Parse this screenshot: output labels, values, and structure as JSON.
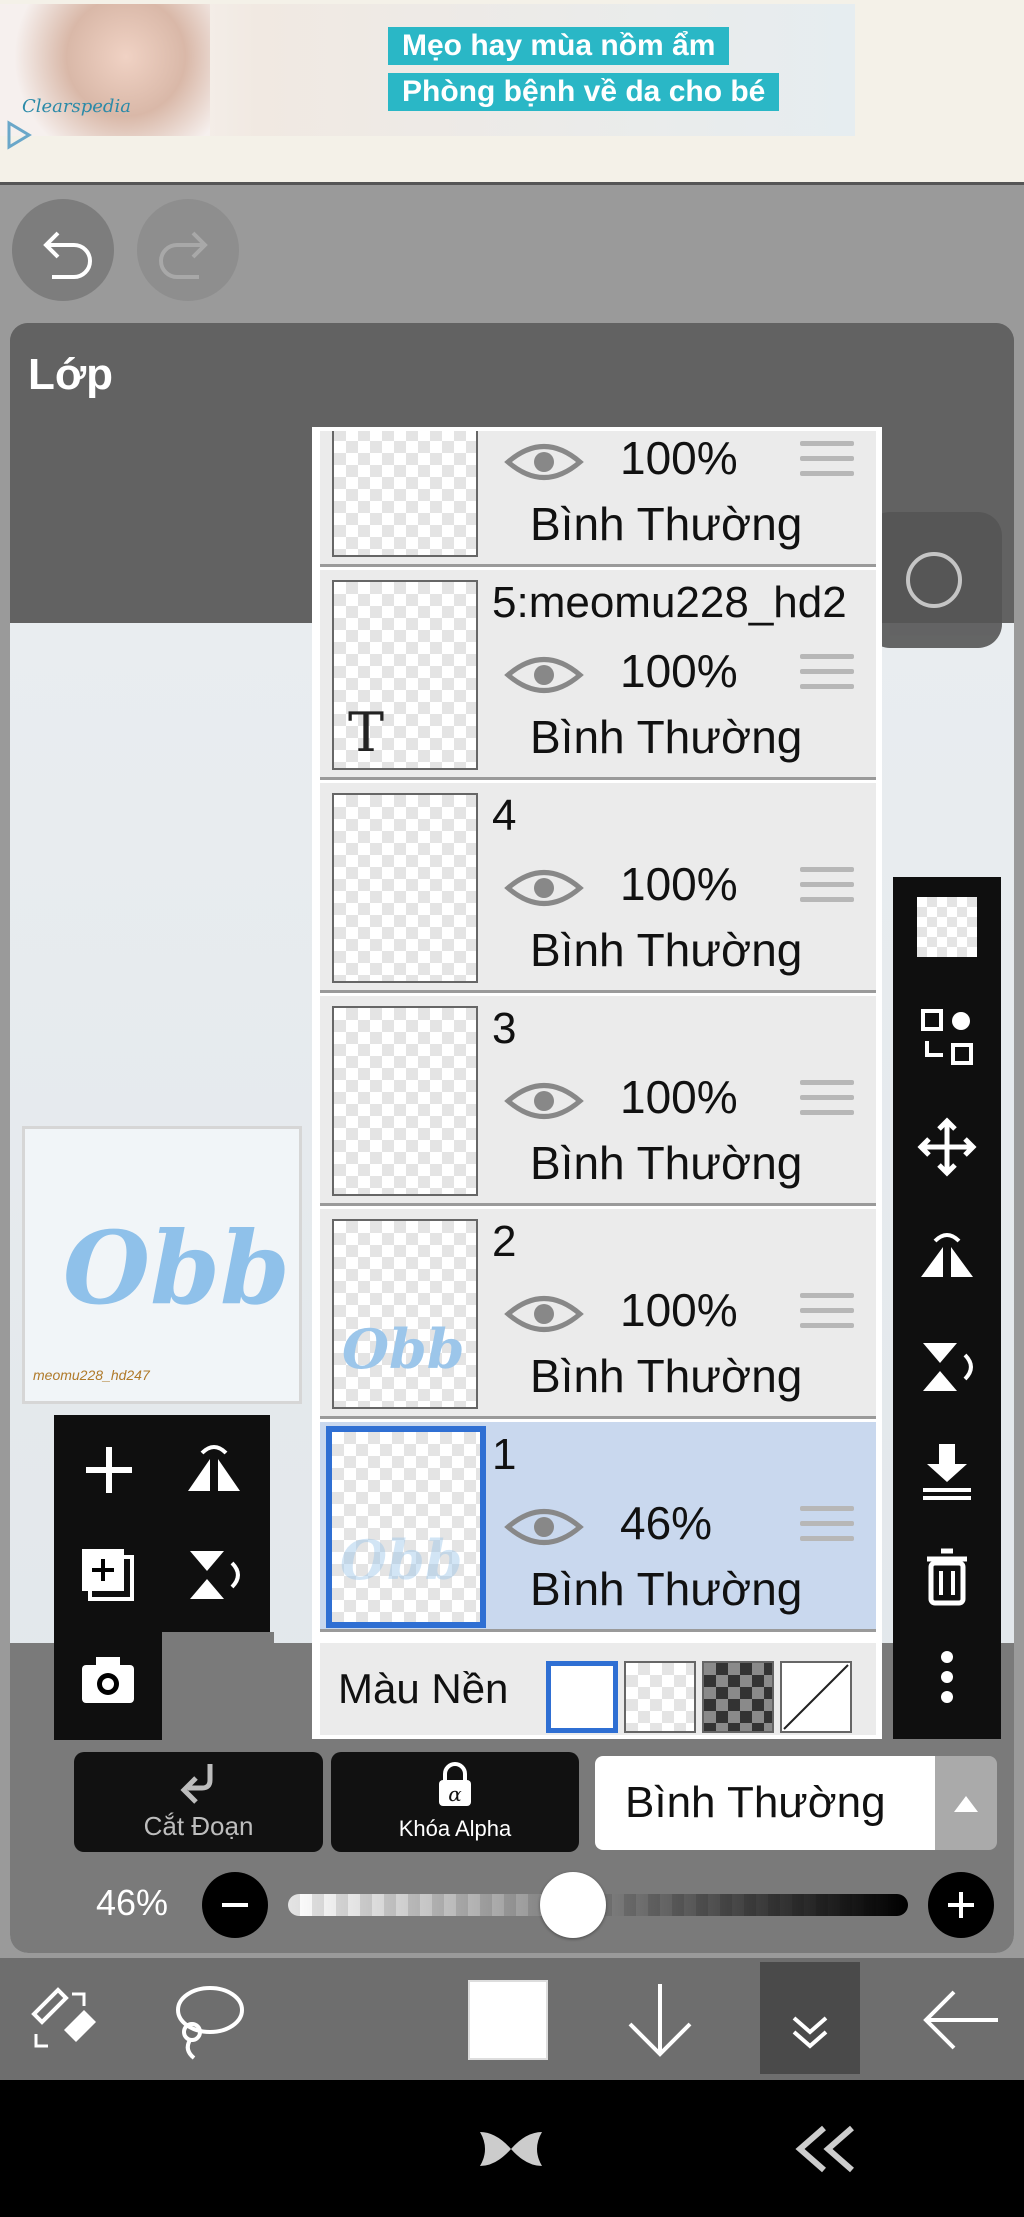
{
  "ad": {
    "line1": "Mẹo hay mùa nồm ẩm",
    "line2": "Phòng bệnh về da cho bé",
    "logo": "Clearspedia"
  },
  "panel": {
    "title": "Lớp"
  },
  "layers": [
    {
      "name": "",
      "opacity": "100%",
      "blend": "Bình Thường"
    },
    {
      "name": "5:meomu228_hd2",
      "opacity": "100%",
      "blend": "Bình Thường",
      "thumb_label": "T"
    },
    {
      "name": "4",
      "opacity": "100%",
      "blend": "Bình Thường"
    },
    {
      "name": "3",
      "opacity": "100%",
      "blend": "Bình Thường"
    },
    {
      "name": "2",
      "opacity": "100%",
      "blend": "Bình Thường"
    },
    {
      "name": "1",
      "opacity": "46%",
      "blend": "Bình Thường"
    }
  ],
  "background": {
    "label": "Màu Nền"
  },
  "actions": {
    "clip_label": "Cắt Đoạn",
    "alpha_label": "Khóa Alpha",
    "blend_mode": "Bình Thường"
  },
  "opacity": {
    "label": "46%",
    "value": 0.46
  },
  "preview": {
    "signature": "meomu228_hd247"
  },
  "colors": {
    "selection": "#2f6fd3",
    "panel": "#6b6b6b",
    "toolbar": "#0f0f0f",
    "ad_accent": "#2ab7c6"
  }
}
